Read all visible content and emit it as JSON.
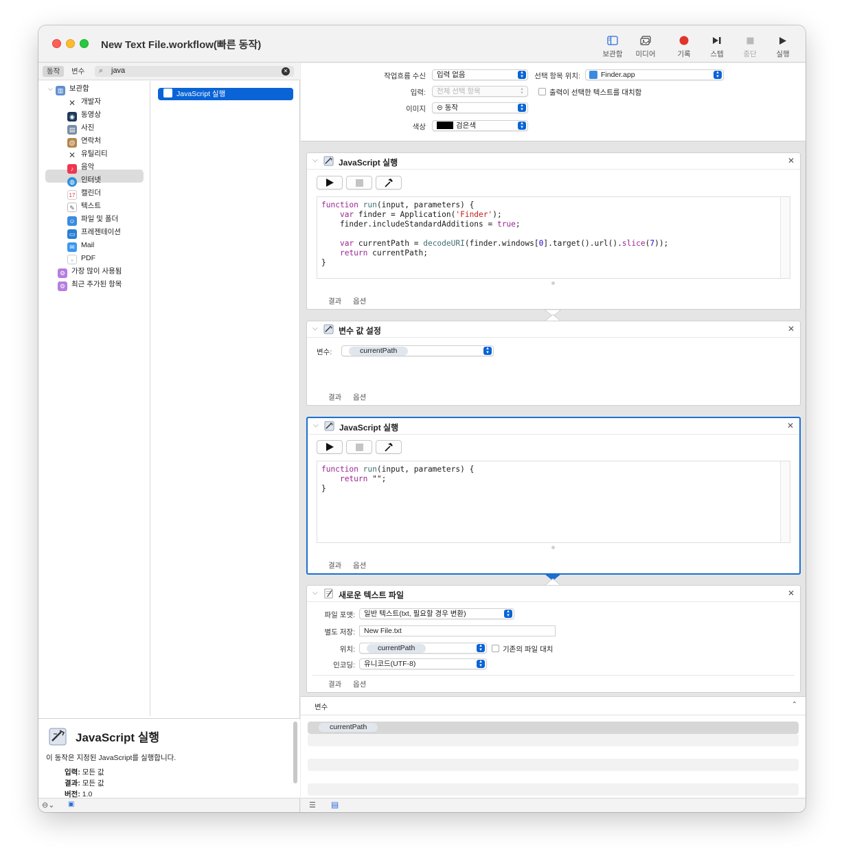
{
  "window": {
    "title": "New Text File.workflow(빠른 동작)"
  },
  "toolbar": {
    "library": "보관함",
    "media": "미디어",
    "record": "기록",
    "step": "스텝",
    "stop": "중단",
    "run": "실행"
  },
  "library_panel": {
    "tab_actions": "동작",
    "tab_variables": "변수",
    "search_value": "java",
    "tree": [
      {
        "label": "보관함",
        "icon": "library-icon"
      },
      {
        "label": "개발자",
        "icon": "tools-icon"
      },
      {
        "label": "동영상",
        "icon": "movie-icon"
      },
      {
        "label": "사진",
        "icon": "photo-icon"
      },
      {
        "label": "연락처",
        "icon": "contacts-icon"
      },
      {
        "label": "유틸리티",
        "icon": "utilities-icon"
      },
      {
        "label": "음악",
        "icon": "music-icon"
      },
      {
        "label": "인터넷",
        "icon": "internet-icon"
      },
      {
        "label": "캘린더",
        "icon": "calendar-icon"
      },
      {
        "label": "텍스트",
        "icon": "text-icon"
      },
      {
        "label": "파일 및 폴더",
        "icon": "finder-icon"
      },
      {
        "label": "프레젠테이션",
        "icon": "presentation-icon"
      },
      {
        "label": "Mail",
        "icon": "mail-icon"
      },
      {
        "label": "PDF",
        "icon": "pdf-icon"
      },
      {
        "label": "가장 많이 사용됨",
        "icon": "smart-folder-icon"
      },
      {
        "label": "최근 추가된 항목",
        "icon": "smart-folder-icon"
      }
    ],
    "selected_result": "JavaScript 실행",
    "description": {
      "title": "JavaScript 실행",
      "text": "이 동작은 지정된 JavaScript를 실행합니다.",
      "input_label": "입력:",
      "input_value": "모든 값",
      "result_label": "결과:",
      "result_value": "모든 값",
      "version_label": "버전:",
      "version_value": "1.0"
    }
  },
  "workflow_settings": {
    "receives_label": "작업흐름 수신",
    "receives_value": "입력 없음",
    "in_label": "선택 항목 위치:",
    "in_value": "Finder.app",
    "input_label": "입력:",
    "input_value": "전체 선택 항목",
    "replace_label": "출력이 선택한 텍스트를 대치함",
    "image_label": "이미지",
    "image_value": "⊝ 동작",
    "color_label": "색상",
    "color_value": "검은색"
  },
  "actions": [
    {
      "title": "JavaScript 실행",
      "code": [
        "function run(input, parameters) {",
        "    var finder = Application('Finder');",
        "    finder.includeStandardAdditions = true;",
        "",
        "    var currentPath = decodeURI(finder.windows[0].target().url().slice(7));",
        "    return currentPath;",
        "}"
      ],
      "footer_results": "결과",
      "footer_options": "옵션"
    },
    {
      "title": "변수 값 설정",
      "variable_label": "변수:",
      "variable_value": "currentPath",
      "footer_results": "결과",
      "footer_options": "옵션"
    },
    {
      "title": "JavaScript 실행",
      "code": [
        "function run(input, parameters) {",
        "    return \"\";",
        "}"
      ],
      "footer_results": "결과",
      "footer_options": "옵션"
    },
    {
      "title": "새로운 텍스트 파일",
      "format_label": "파일 포맷:",
      "format_value": "일반 텍스트(txt, 필요할 경우 변환)",
      "save_as_label": "별도 저장:",
      "save_as_value": "New File.txt",
      "where_label": "위치:",
      "where_value": "currentPath",
      "replace_label": "기존의 파일 대치",
      "encoding_label": "인코딩:",
      "encoding_value": "유니코드(UTF-8)",
      "footer_results": "결과",
      "footer_options": "옵션"
    }
  ],
  "variables_panel": {
    "title": "변수",
    "items": [
      "currentPath"
    ]
  },
  "colors": {
    "accent": "#0a64d6",
    "record": "#e0352b",
    "selected_border": "#1a6fd1"
  }
}
